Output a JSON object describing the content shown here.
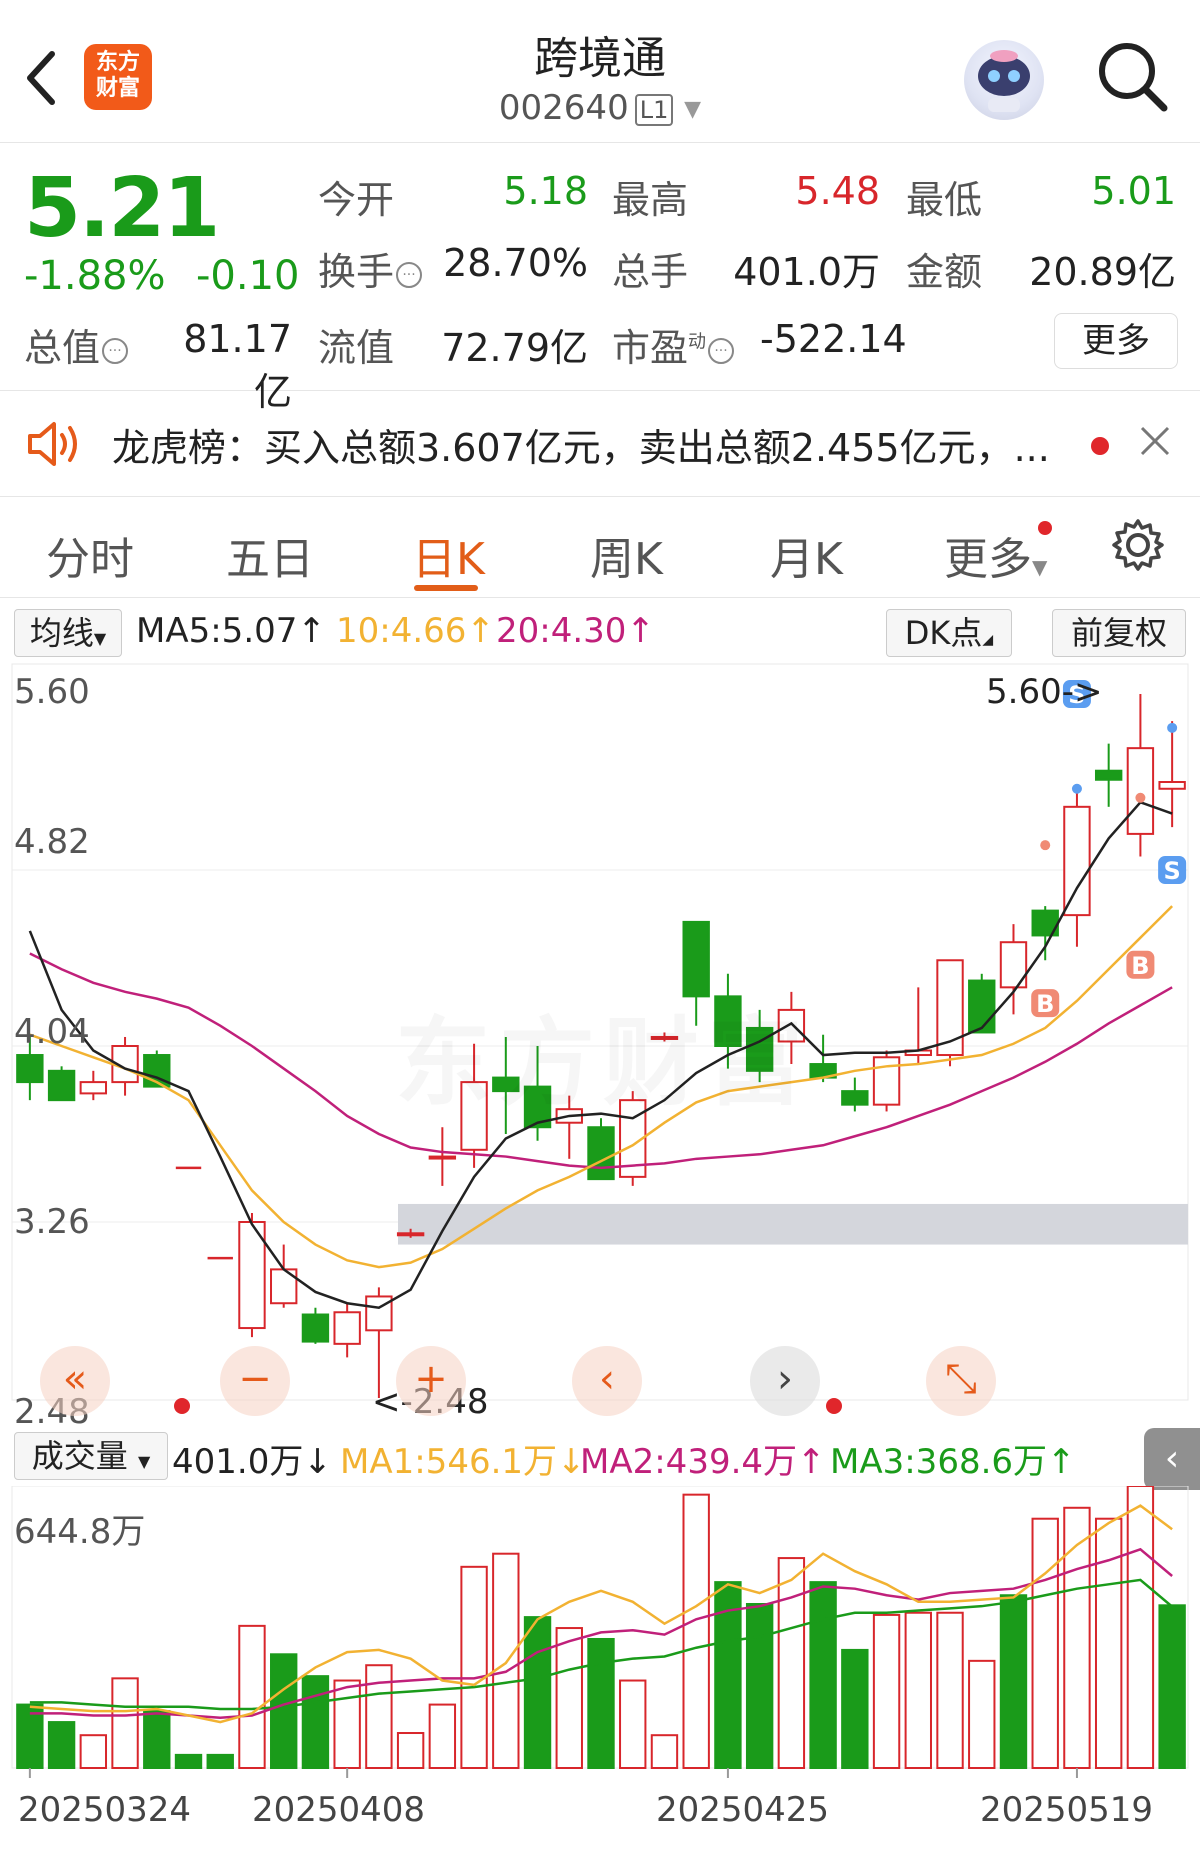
{
  "header": {
    "back_icon": "chevron-left-icon",
    "logo_text_line1": "东方",
    "logo_text_line2": "财富",
    "stock_name": "跨境通",
    "stock_code": "002640",
    "market_badge": "L1",
    "search_icon": "search-icon"
  },
  "quote": {
    "price": "5.21",
    "change_pct": "-1.88%",
    "change": "-0.10",
    "fields": [
      {
        "label": "今开",
        "value": "5.18",
        "color": "green"
      },
      {
        "label": "最高",
        "value": "5.48",
        "color": "red"
      },
      {
        "label": "最低",
        "value": "5.01",
        "color": "green"
      },
      {
        "label": "换手",
        "value": "28.70%",
        "color": "dark"
      },
      {
        "label": "总手",
        "value": "401.0万",
        "color": "dark"
      },
      {
        "label": "金额",
        "value": "20.89亿",
        "color": "dark"
      },
      {
        "label": "总值",
        "value": "81.17亿",
        "color": "dark"
      },
      {
        "label": "流值",
        "value": "72.79亿",
        "color": "dark"
      },
      {
        "label": "市盈",
        "value": "-522.14",
        "color": "dark"
      }
    ],
    "pe_superscript": "动",
    "more_label": "更多"
  },
  "notice": {
    "text": "龙虎榜：买入总额3.607亿元，卖出总额2.455亿元，..."
  },
  "tabs": [
    "分时",
    "五日",
    "日K",
    "周K",
    "月K",
    "更多"
  ],
  "active_tab": "日K",
  "indicator_bar": {
    "selector": "均线",
    "ma5": "MA5:5.07",
    "ma10": "10:4.66",
    "ma20": "20:4.30",
    "dk_label": "DK点",
    "adjust_label": "前复权"
  },
  "price_axis": [
    "5.60",
    "4.82",
    "4.04",
    "3.26",
    "2.48"
  ],
  "annotations": {
    "high_marker": "5.60->",
    "low_marker": "<-2.48"
  },
  "volume_bar": {
    "selector": "成交量",
    "vol": "401.0万",
    "ma1": "MA1:546.1万",
    "ma2": "MA2:439.4万",
    "ma3": "MA3:368.6万",
    "axis_max": "644.8万"
  },
  "dates": [
    "20250324",
    "20250408",
    "20250425",
    "20250519"
  ],
  "colors": {
    "up": "#d8262b",
    "down": "#1a9b1a",
    "ma5": "#222222",
    "ma10": "#f2b232",
    "ma20": "#c0207a",
    "accent": "#e25d18"
  },
  "chart_data": {
    "type": "candlestick",
    "ylim": [
      2.48,
      5.6
    ],
    "candles": [
      {
        "o": 4.0,
        "h": 4.08,
        "l": 3.8,
        "c": 3.88
      },
      {
        "o": 3.93,
        "h": 3.95,
        "l": 3.8,
        "c": 3.8
      },
      {
        "o": 3.83,
        "h": 3.93,
        "l": 3.8,
        "c": 3.88
      },
      {
        "o": 3.88,
        "h": 4.08,
        "l": 3.82,
        "c": 4.04
      },
      {
        "o": 4.0,
        "h": 4.02,
        "l": 3.86,
        "c": 3.86
      },
      {
        "o": 3.5,
        "h": 3.5,
        "l": 3.5,
        "c": 3.5
      },
      {
        "o": 3.1,
        "h": 3.1,
        "l": 3.1,
        "c": 3.1
      },
      {
        "o": 2.79,
        "h": 3.3,
        "l": 2.75,
        "c": 3.26
      },
      {
        "o": 2.9,
        "h": 3.16,
        "l": 2.88,
        "c": 3.05
      },
      {
        "o": 2.85,
        "h": 2.88,
        "l": 2.72,
        "c": 2.73
      },
      {
        "o": 2.72,
        "h": 2.9,
        "l": 2.66,
        "c": 2.86
      },
      {
        "o": 2.78,
        "h": 2.97,
        "l": 2.48,
        "c": 2.93
      },
      {
        "o": 3.21,
        "h": 3.23,
        "l": 3.19,
        "c": 3.21
      },
      {
        "o": 3.55,
        "h": 3.68,
        "l": 3.42,
        "c": 3.55
      },
      {
        "o": 3.58,
        "h": 4.05,
        "l": 3.5,
        "c": 3.88
      },
      {
        "o": 3.9,
        "h": 4.08,
        "l": 3.65,
        "c": 3.84
      },
      {
        "o": 3.86,
        "h": 4.04,
        "l": 3.62,
        "c": 3.68
      },
      {
        "o": 3.7,
        "h": 3.82,
        "l": 3.54,
        "c": 3.76
      },
      {
        "o": 3.68,
        "h": 3.72,
        "l": 3.45,
        "c": 3.45
      },
      {
        "o": 3.46,
        "h": 3.84,
        "l": 3.42,
        "c": 3.8
      },
      {
        "o": 4.08,
        "h": 4.1,
        "l": 4.06,
        "c": 4.08
      },
      {
        "o": 4.59,
        "h": 4.59,
        "l": 4.13,
        "c": 4.26
      },
      {
        "o": 4.26,
        "h": 4.36,
        "l": 3.94,
        "c": 4.04
      },
      {
        "o": 4.12,
        "h": 4.2,
        "l": 3.88,
        "c": 3.93
      },
      {
        "o": 4.06,
        "h": 4.28,
        "l": 3.96,
        "c": 4.2
      },
      {
        "o": 3.96,
        "h": 4.09,
        "l": 3.88,
        "c": 3.9
      },
      {
        "o": 3.84,
        "h": 3.9,
        "l": 3.75,
        "c": 3.78
      },
      {
        "o": 3.78,
        "h": 4.02,
        "l": 3.75,
        "c": 3.99
      },
      {
        "o": 4.0,
        "h": 4.3,
        "l": 3.96,
        "c": 4.02
      },
      {
        "o": 4.0,
        "h": 4.42,
        "l": 3.95,
        "c": 4.42
      },
      {
        "o": 4.33,
        "h": 4.36,
        "l": 4.1,
        "c": 4.1
      },
      {
        "o": 4.3,
        "h": 4.58,
        "l": 4.18,
        "c": 4.5
      },
      {
        "o": 4.64,
        "h": 4.66,
        "l": 4.42,
        "c": 4.53
      },
      {
        "o": 4.62,
        "h": 5.2,
        "l": 4.48,
        "c": 5.1
      },
      {
        "o": 5.26,
        "h": 5.38,
        "l": 5.1,
        "c": 5.22
      },
      {
        "o": 4.98,
        "h": 5.6,
        "l": 4.88,
        "c": 5.36
      },
      {
        "o": 5.18,
        "h": 5.48,
        "l": 5.01,
        "c": 5.21
      }
    ],
    "ma5": [
      4.55,
      4.2,
      4.02,
      3.94,
      3.9,
      3.84,
      3.55,
      3.25,
      3.05,
      2.95,
      2.9,
      2.88,
      2.96,
      3.22,
      3.46,
      3.63,
      3.7,
      3.73,
      3.74,
      3.72,
      3.8,
      3.92,
      4.0,
      4.06,
      4.14,
      4.0,
      4.01,
      4.01,
      4.02,
      4.06,
      4.12,
      4.28,
      4.48,
      4.74,
      4.96,
      5.12,
      5.07
    ],
    "ma10": [
      4.09,
      4.04,
      3.99,
      3.94,
      3.88,
      3.8,
      3.6,
      3.4,
      3.26,
      3.16,
      3.09,
      3.06,
      3.08,
      3.14,
      3.23,
      3.32,
      3.4,
      3.46,
      3.53,
      3.6,
      3.7,
      3.79,
      3.84,
      3.86,
      3.88,
      3.9,
      3.93,
      3.95,
      3.96,
      3.98,
      4.0,
      4.05,
      4.12,
      4.24,
      4.38,
      4.52,
      4.66
    ],
    "ma20": [
      4.45,
      4.38,
      4.32,
      4.28,
      4.25,
      4.21,
      4.13,
      4.04,
      3.94,
      3.84,
      3.73,
      3.65,
      3.59,
      3.57,
      3.56,
      3.55,
      3.53,
      3.51,
      3.5,
      3.51,
      3.52,
      3.54,
      3.55,
      3.56,
      3.58,
      3.6,
      3.64,
      3.68,
      3.73,
      3.78,
      3.84,
      3.9,
      3.97,
      4.05,
      4.14,
      4.22,
      4.3
    ],
    "volume_ylim": [
      0,
      644.8
    ],
    "volume": [
      {
        "v": 145,
        "up": false
      },
      {
        "v": 105,
        "up": false
      },
      {
        "v": 75,
        "up": true
      },
      {
        "v": 205,
        "up": true
      },
      {
        "v": 130,
        "up": false
      },
      {
        "v": 30,
        "up": false
      },
      {
        "v": 30,
        "up": false
      },
      {
        "v": 325,
        "up": true
      },
      {
        "v": 260,
        "up": false
      },
      {
        "v": 210,
        "up": false
      },
      {
        "v": 200,
        "up": true
      },
      {
        "v": 235,
        "up": true
      },
      {
        "v": 80,
        "up": true
      },
      {
        "v": 145,
        "up": true
      },
      {
        "v": 460,
        "up": true
      },
      {
        "v": 490,
        "up": true
      },
      {
        "v": 345,
        "up": false
      },
      {
        "v": 320,
        "up": true
      },
      {
        "v": 295,
        "up": false
      },
      {
        "v": 200,
        "up": true
      },
      {
        "v": 75,
        "up": true
      },
      {
        "v": 625,
        "up": true
      },
      {
        "v": 425,
        "up": false
      },
      {
        "v": 375,
        "up": false
      },
      {
        "v": 480,
        "up": true
      },
      {
        "v": 425,
        "up": false
      },
      {
        "v": 270,
        "up": false
      },
      {
        "v": 350,
        "up": true
      },
      {
        "v": 355,
        "up": true
      },
      {
        "v": 355,
        "up": true
      },
      {
        "v": 245,
        "up": true
      },
      {
        "v": 395,
        "up": false
      },
      {
        "v": 570,
        "up": true
      },
      {
        "v": 595,
        "up": true
      },
      {
        "v": 570,
        "up": true
      },
      {
        "v": 665,
        "up": true
      },
      {
        "v": 372,
        "up": false
      }
    ],
    "vol_ma1": [
      140,
      135,
      130,
      130,
      135,
      120,
      105,
      125,
      180,
      230,
      265,
      270,
      250,
      200,
      190,
      240,
      340,
      380,
      405,
      380,
      330,
      370,
      420,
      400,
      430,
      490,
      450,
      420,
      380,
      380,
      385,
      390,
      445,
      510,
      560,
      600,
      546
    ],
    "vol_ma2": [
      125,
      125,
      120,
      120,
      125,
      120,
      115,
      120,
      145,
      165,
      185,
      195,
      200,
      205,
      205,
      220,
      265,
      290,
      310,
      315,
      305,
      340,
      360,
      370,
      390,
      415,
      410,
      395,
      385,
      400,
      405,
      410,
      430,
      455,
      475,
      500,
      439
    ],
    "vol_ma3": [
      150,
      150,
      145,
      140,
      140,
      140,
      135,
      135,
      140,
      150,
      160,
      170,
      175,
      180,
      185,
      195,
      205,
      225,
      240,
      250,
      255,
      275,
      290,
      300,
      320,
      340,
      355,
      355,
      360,
      365,
      370,
      380,
      395,
      410,
      420,
      430,
      369
    ]
  }
}
